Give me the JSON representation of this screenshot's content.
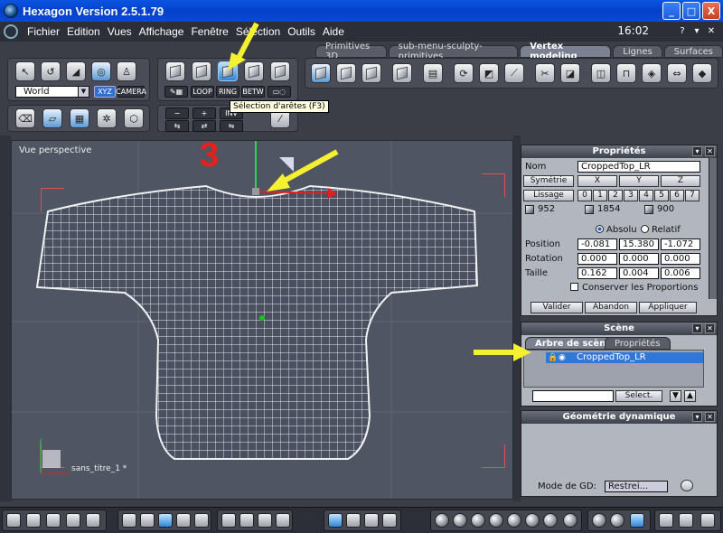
{
  "titlebar": {
    "title": "Hexagon Version 2.5.1.79",
    "minimize": "_",
    "maximize": "□",
    "close": "X"
  },
  "menubar": {
    "items": [
      "Fichier",
      "Edition",
      "Vues",
      "Affichage",
      "Fenêtre",
      "Sélection",
      "Outils",
      "Aide"
    ],
    "clock": "16:02"
  },
  "toolbar": {
    "coord_space": "World",
    "mode_xyz": "XYZ",
    "mode_camera": "CAMERA",
    "loop": "LOOP",
    "ring": "RING",
    "betw": "BETW",
    "minus": "−",
    "plus": "+",
    "inv": "INV",
    "tooltip": "Sélection d'arêtes (F3)"
  },
  "tabs": [
    "Primitives 3D",
    "sub-menu-sculpty-primitives",
    "Vertex modeling",
    "Lignes",
    "Surfaces"
  ],
  "active_tab": "Vertex modeling",
  "viewport": {
    "label": "Vue perspective",
    "document": "sans_titre_1 *",
    "step_label": "3"
  },
  "properties": {
    "title": "Propriétés",
    "name_label": "Nom",
    "name_value": "CroppedTop_LR",
    "symmetry_label": "Symétrie",
    "axes": [
      "X",
      "Y",
      "Z"
    ],
    "smoothing_label": "Lissage",
    "levels": [
      "0",
      "1",
      "2",
      "3",
      "4",
      "5",
      "6",
      "7"
    ],
    "counts": [
      "952",
      "1854",
      "900"
    ],
    "absolute": "Absolu",
    "relative": "Relatif",
    "rows": [
      {
        "label": "Position",
        "values": [
          "-0.081",
          "15.380",
          "-1.072"
        ]
      },
      {
        "label": "Rotation",
        "values": [
          "0.000",
          "0.000",
          "0.000"
        ]
      },
      {
        "label": "Taille",
        "values": [
          "0.162",
          "0.004",
          "0.006"
        ]
      }
    ],
    "keep_proportions": "Conserver les Proportions",
    "validate": "Valider",
    "cancel": "Abandon",
    "apply": "Appliquer"
  },
  "scene": {
    "title": "Scène",
    "tabs": [
      "Arbre de scène",
      "Propriétés"
    ],
    "item": "CroppedTop_LR",
    "select_button": "Select."
  },
  "dynamic_geometry": {
    "title": "Géométrie dynamique",
    "mode_label": "Mode de GD:",
    "mode_value": "Restrei..."
  },
  "annotation_color": "#f5f030"
}
